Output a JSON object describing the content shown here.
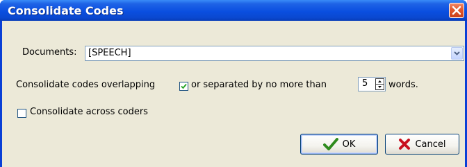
{
  "window": {
    "title": "Consolidate Codes"
  },
  "form": {
    "documents_label": "Documents:",
    "documents_value": "[SPEECH]",
    "overlap_label": "Consolidate codes overlapping",
    "overlap_checked": true,
    "separated_label": "or separated by no more than",
    "separation_value": "5",
    "words_label": "words.",
    "across_coders_label": "Consolidate across coders",
    "across_coders_checked": false
  },
  "buttons": {
    "ok_label": "OK",
    "cancel_label": "Cancel"
  },
  "icons": {
    "close": "close-icon",
    "dropdown": "chevron-down-icon",
    "ok": "checkmark-icon",
    "cancel": "x-icon"
  },
  "colors": {
    "titlebar": "#0a4fe0",
    "client_bg": "#ece9d8",
    "ok_check": "#2e8b1e",
    "cancel_x": "#c8101e"
  }
}
